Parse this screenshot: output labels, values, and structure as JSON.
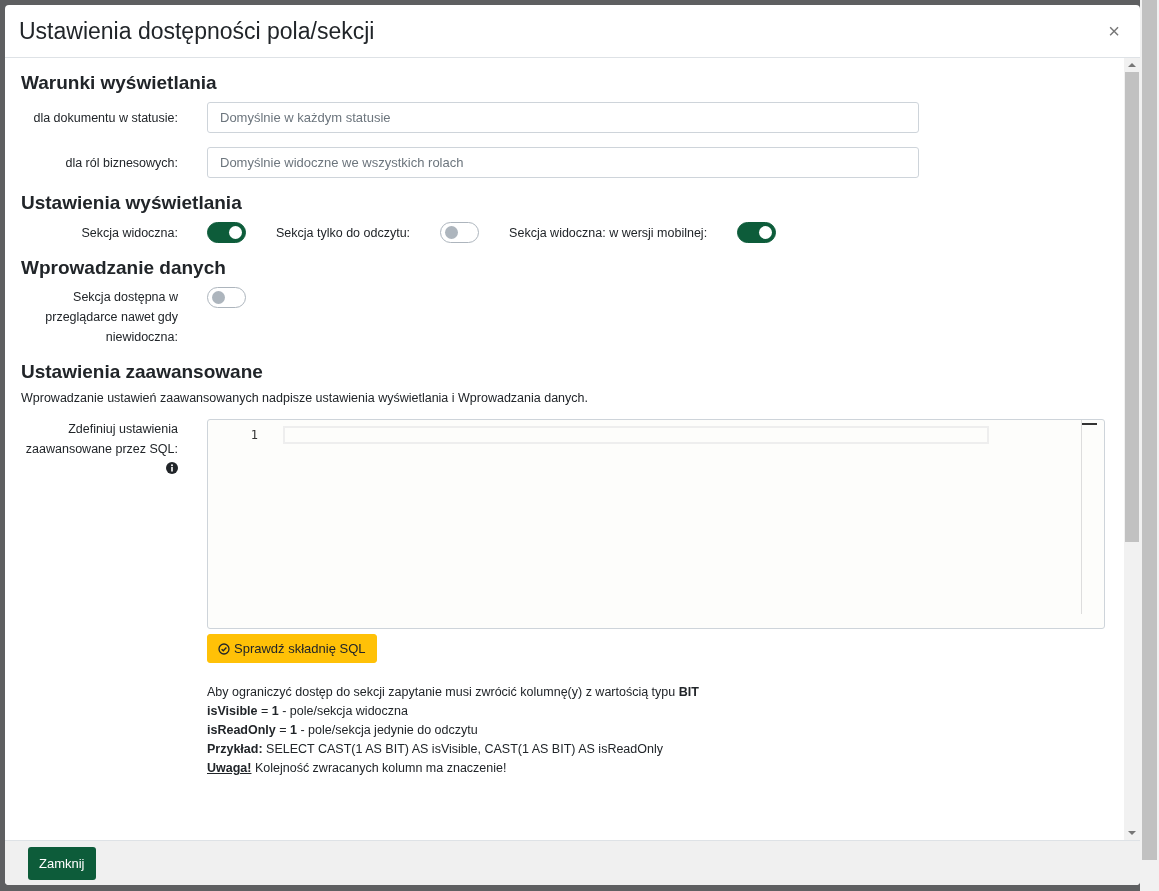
{
  "dialog": {
    "title": "Ustawienia dostępności pola/sekcji",
    "close": "×"
  },
  "sections": [
    {
      "title": "Warunki wyświetlania",
      "kind": "fields",
      "fields": [
        {
          "label": "dla dokumentu w statusie:",
          "placeholder": "Domyślnie w każdym statusie"
        },
        {
          "label": "dla ról biznesowych:",
          "placeholder": "Domyślnie widoczne we wszystkich rolach"
        }
      ]
    },
    {
      "title": "Ustawienia wyświetlania",
      "kind": "inline_toggles",
      "toggles": [
        {
          "label": "Sekcja widoczna:",
          "on": true
        },
        {
          "label": "Sekcja tylko do odczytu:",
          "on": false
        },
        {
          "label": "Sekcja widoczna: w wersji mobilnej:",
          "on": true
        }
      ]
    },
    {
      "title": "Wprowadzanie danych",
      "kind": "toggles",
      "toggles": [
        {
          "label": "Sekcja dostępna w przeglądarce nawet gdy niewidoczna:",
          "on": false
        }
      ]
    },
    {
      "title": "Ustawienia zaawansowane",
      "kind": "advanced",
      "description": "Wprowadzanie ustawień zaawansowanych nadpisze ustawienia wyświetlania i Wprowadzania danych.",
      "editor": {
        "label": "Zdefiniuj ustawienia zaawansowane przez SQL:",
        "line_numbers": [
          "1"
        ]
      },
      "check_button": "Sprawdź składnię SQL",
      "help": [
        {
          "kind": "text",
          "text": "Aby ograniczyć dostęp do sekcji zapytanie musi zwrócić kolumnę(y) z wartością typu **BIT**"
        },
        {
          "kind": "text",
          "text": "**isVisible** = **1** - pole/sekcja widoczna"
        },
        {
          "kind": "text",
          "text": "**isReadOnly** = **1** - pole/sekcja jedynie do odczytu"
        },
        {
          "kind": "text",
          "text": "**Przykład:** SELECT CAST(1 AS BIT) AS isVisible, CAST(1 AS BIT) AS isReadOnly"
        },
        {
          "kind": "warning",
          "label": "Uwaga!",
          "text": "Kolejność zwracanych kolumn ma znaczenie!"
        }
      ]
    }
  ],
  "footer": {
    "close_button": "Zamknij"
  }
}
